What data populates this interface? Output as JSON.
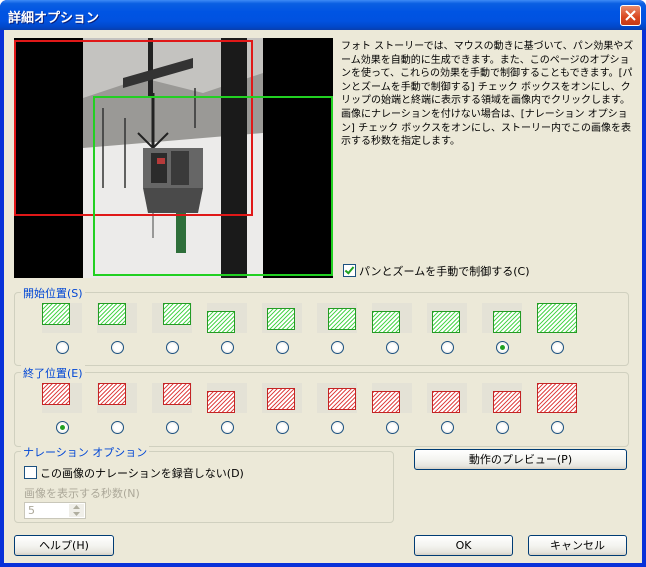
{
  "window": {
    "title": "詳細オプション",
    "close_icon": "close-icon"
  },
  "description": {
    "para1": "フォト ストーリーでは、マウスの動きに基づいて、パン効果やズーム効果を自動的に生成できます。また、このページのオプションを使って、これらの効果を手動で制御することもできます。[パンとズームを手動で制御する] チェック ボックスをオンにし、クリップの始端と終端に表示する領域を画像内でクリックします。",
    "para2": "画像にナレーションを付けない場合は、[ナレーション オプション] チェック ボックスをオンにし、ストーリー内でこの画像を表示する秒数を指定します。"
  },
  "manual_pan_zoom": {
    "label": "パンとズームを手動で制御する(C)",
    "checked": true
  },
  "start_position": {
    "label": "開始位置(S)",
    "selected_index": 8,
    "count": 10
  },
  "end_position": {
    "label": "終了位置(E)",
    "selected_index": 0,
    "count": 10
  },
  "narration": {
    "legend": "ナレーション オプション",
    "no_record_label": "この画像のナレーションを録音しない(D)",
    "no_record_checked": false,
    "seconds_label": "画像を表示する秒数(N)",
    "seconds_value": "5"
  },
  "buttons": {
    "preview": "動作のプレビュー(P)",
    "help": "ヘルプ(H)",
    "ok": "OK",
    "cancel": "キャンセル"
  },
  "colors": {
    "start_rect": "#e01818",
    "end_rect": "#22d022",
    "title_bar": "#0054e3"
  }
}
